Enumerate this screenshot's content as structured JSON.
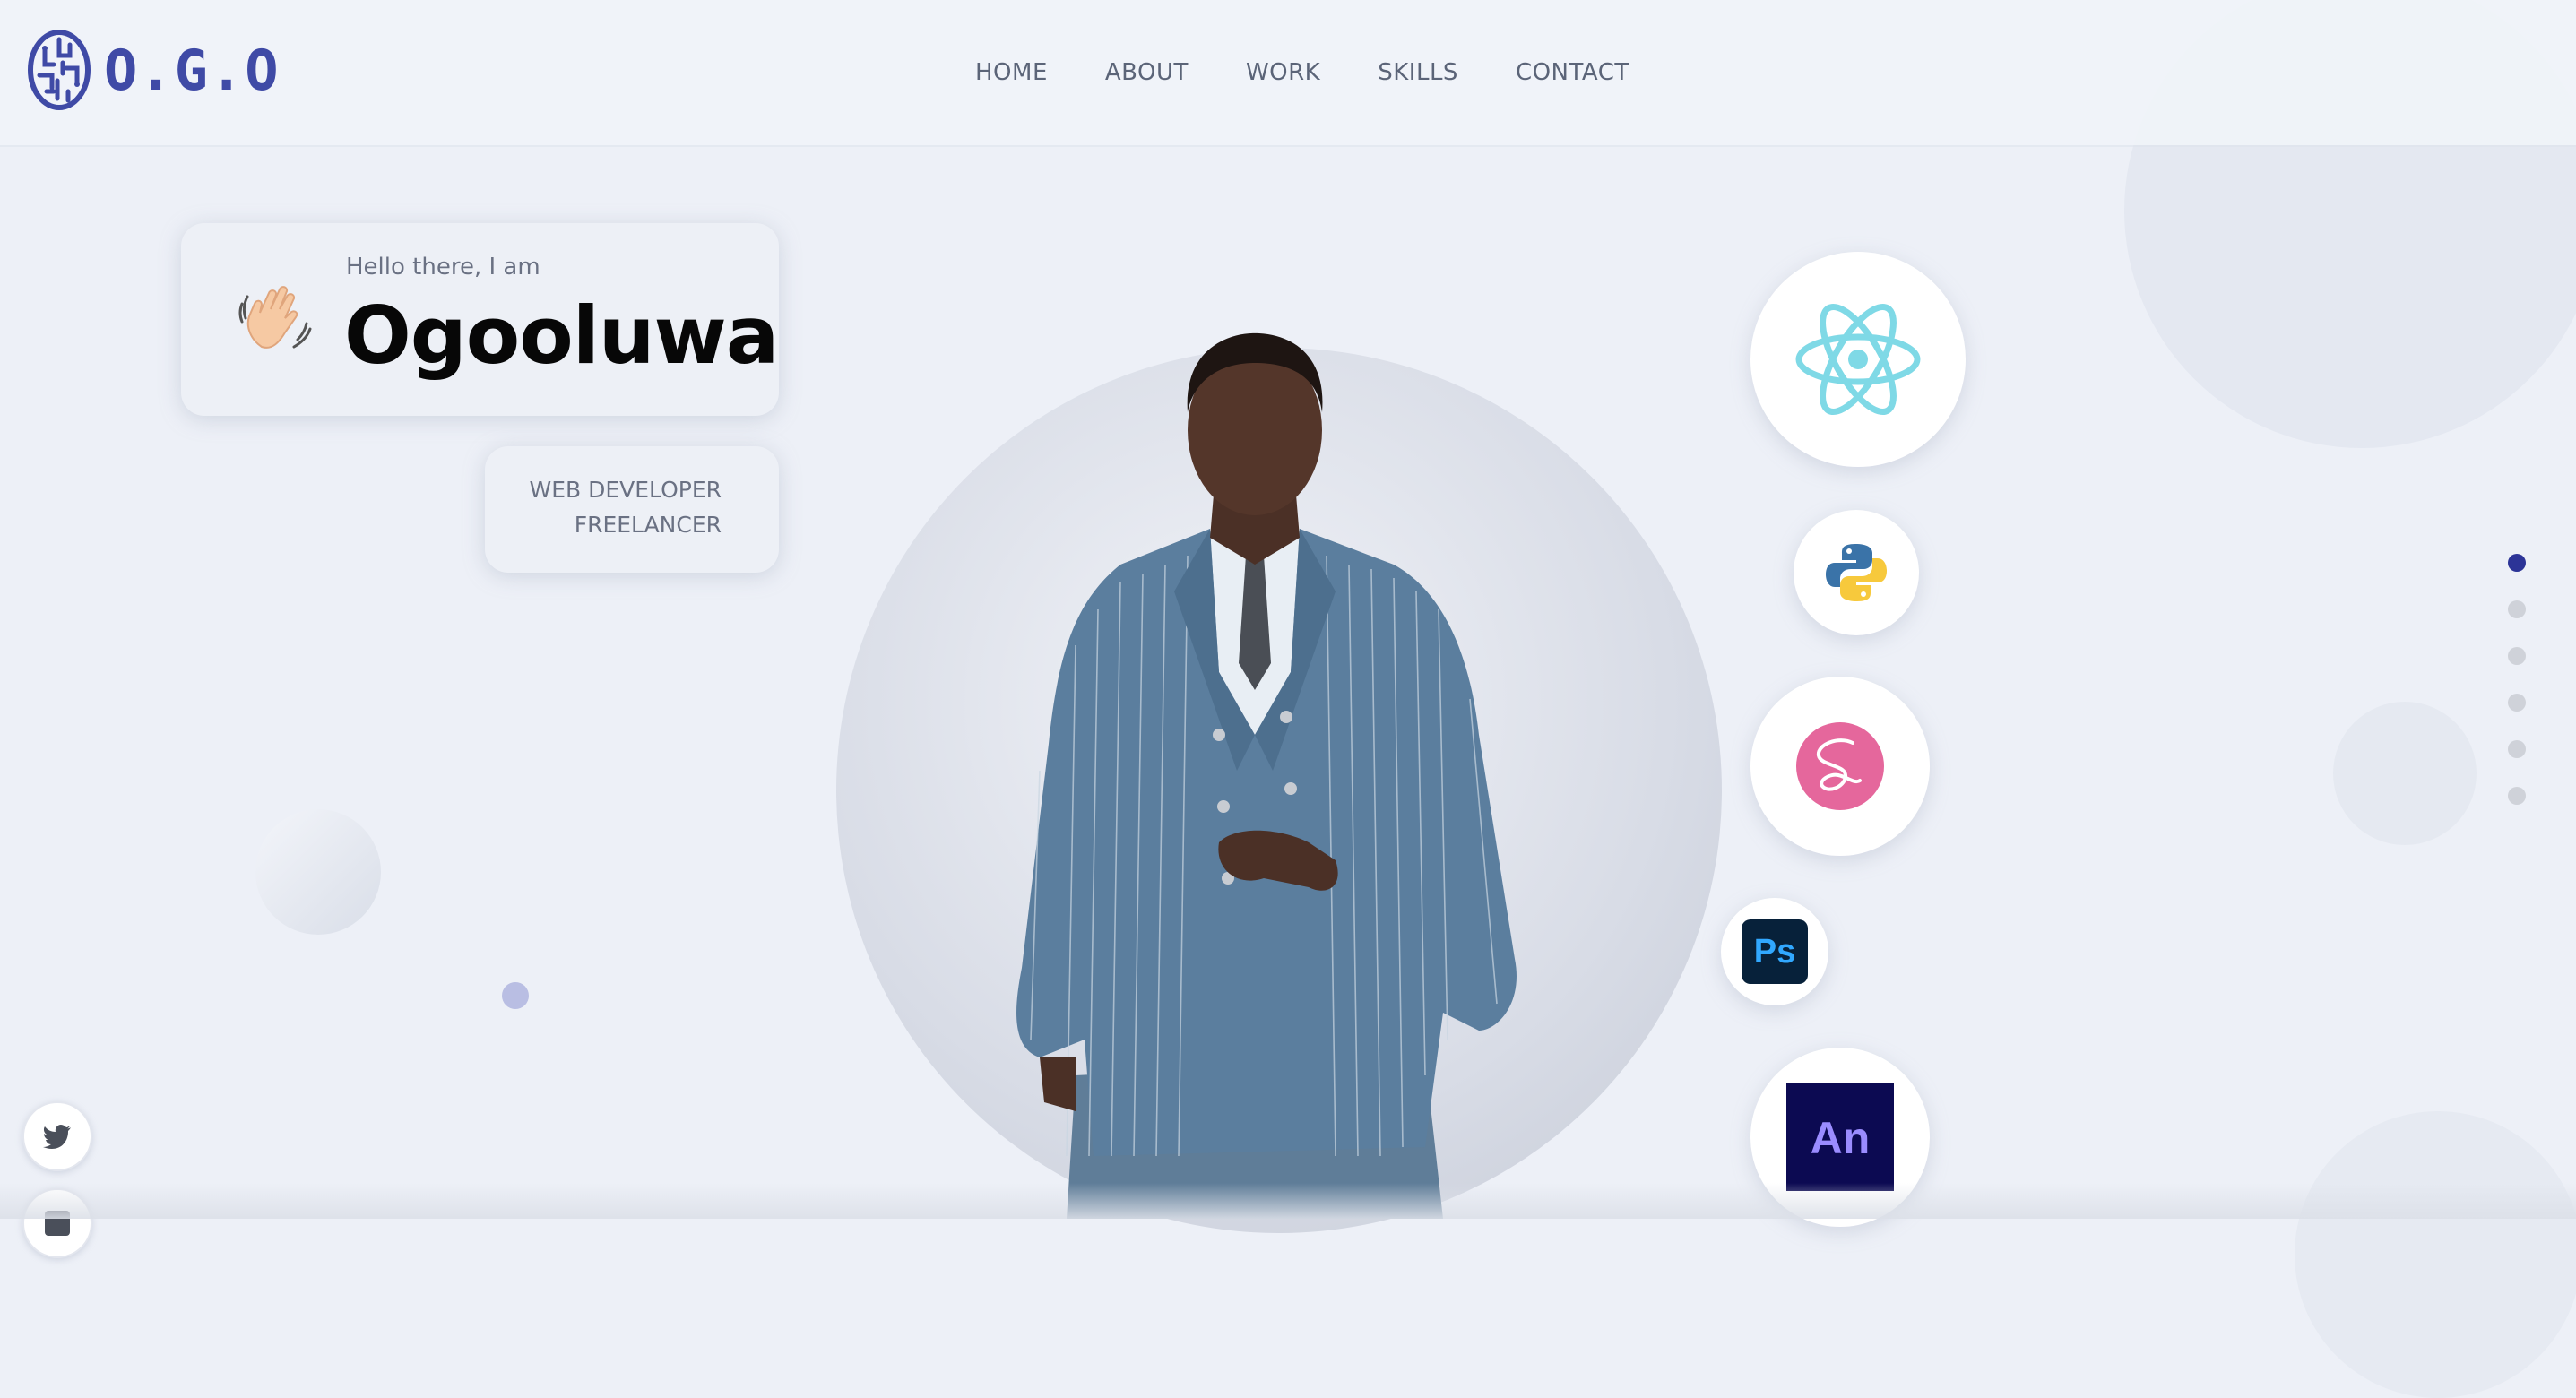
{
  "header": {
    "logo_text": "O.G.O",
    "nav": [
      {
        "label": "HOME"
      },
      {
        "label": "ABOUT"
      },
      {
        "label": "WORK"
      },
      {
        "label": "SKILLS"
      },
      {
        "label": "CONTACT"
      }
    ]
  },
  "hero": {
    "greeting": "Hello there, I am",
    "name": "Ogooluwa",
    "roles": [
      "WEB DEVELOPER",
      "FREELANCER"
    ]
  },
  "skills": [
    {
      "icon": "react-icon"
    },
    {
      "icon": "python-icon"
    },
    {
      "icon": "sass-icon"
    },
    {
      "icon": "photoshop-icon",
      "text": "Ps"
    },
    {
      "icon": "animate-icon",
      "text": "An"
    }
  ],
  "section_dots": {
    "count": 6,
    "active": 0
  },
  "social": [
    {
      "icon": "twitter-icon"
    },
    {
      "icon": "linkedin-icon"
    }
  ],
  "colors": {
    "brand": "#3f4aa6",
    "active_dot": "#2c3497",
    "background": "#edf0f7"
  }
}
